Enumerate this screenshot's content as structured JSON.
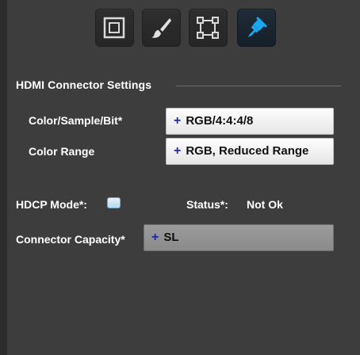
{
  "tabs": [
    {
      "icon": "frame-icon",
      "active": false
    },
    {
      "icon": "brush-icon",
      "active": false
    },
    {
      "icon": "crop-icon",
      "active": false
    },
    {
      "icon": "connector-plug-icon",
      "active": true
    }
  ],
  "section": {
    "title": "HDMI Connector Settings"
  },
  "color_sample": {
    "label": "Color/Sample/Bit*",
    "plus": "+",
    "value": "RGB/4:4:4/8"
  },
  "color_range": {
    "label": "Color Range",
    "plus": "+",
    "value": "RGB, Reduced Range"
  },
  "hdcp": {
    "label": "HDCP Mode*:",
    "status_label": "Status*:",
    "status_value": "Not Ok"
  },
  "capacity": {
    "label": "Connector Capacity*",
    "plus": "+",
    "value": "SL"
  },
  "colors": {
    "background": "#3d3d3d",
    "accent": "#1aa7ee",
    "plus": "#2227b8"
  }
}
